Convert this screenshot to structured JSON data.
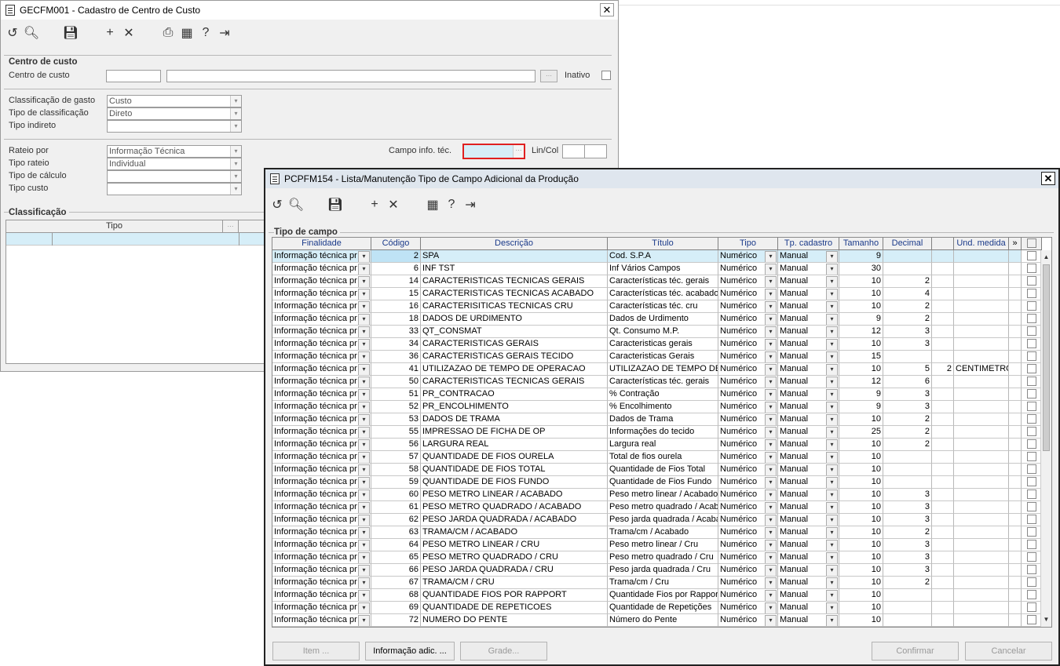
{
  "win1": {
    "title": "GECFM001 - Cadastro de Centro de Custo",
    "group_centro": "Centro de custo",
    "lbl_centro": "Centro de custo",
    "lbl_inativo": "Inativo",
    "lbl_class_gasto": "Classificação de gasto",
    "val_class_gasto": "Custo",
    "lbl_tipo_class": "Tipo de classificação",
    "val_tipo_class": "Direto",
    "lbl_tipo_indireto": "Tipo indireto",
    "lbl_rateio_por": "Rateio por",
    "val_rateio_por": "Informação Técnica",
    "lbl_tipo_rateio": "Tipo rateio",
    "val_tipo_rateio": "Individual",
    "lbl_tipo_calculo": "Tipo de cálculo",
    "lbl_tipo_custo": "Tipo custo",
    "lbl_campo_info": "Campo info. téc.",
    "lbl_lincol": "Lin/Col",
    "group_classif": "Classificação",
    "col_tipo": "Tipo"
  },
  "win2": {
    "title": "PCPFM154 - Lista/Manutenção Tipo de Campo Adicional da Produção",
    "group": "Tipo de campo",
    "columns": [
      "Finalidade",
      "Código",
      "Descrição",
      "Título",
      "Tipo",
      "Tp. cadastro",
      "Tamanho",
      "Decimal",
      "",
      "Und. medida",
      "»",
      ""
    ],
    "rows": [
      {
        "fin": "Informação técnica pr",
        "cod": "2",
        "desc": "SPA",
        "tit": "Cod. S.P.A",
        "tipo": "Numérico",
        "tpc": "Manual",
        "tam": "9",
        "dec": "",
        "x": "",
        "und": ""
      },
      {
        "fin": "Informação técnica pr",
        "cod": "6",
        "desc": "INF TST",
        "tit": "Inf Vários Campos",
        "tipo": "Numérico",
        "tpc": "Manual",
        "tam": "30",
        "dec": "",
        "x": "",
        "und": ""
      },
      {
        "fin": "Informação técnica pr",
        "cod": "14",
        "desc": "CARACTERISTICAS TECNICAS GERAIS",
        "tit": "Características téc. gerais",
        "tipo": "Numérico",
        "tpc": "Manual",
        "tam": "10",
        "dec": "2",
        "x": "",
        "und": ""
      },
      {
        "fin": "Informação técnica pr",
        "cod": "15",
        "desc": "CARACTERISTICAS TECNICAS ACABADO",
        "tit": "Características téc. acabado",
        "tipo": "Numérico",
        "tpc": "Manual",
        "tam": "10",
        "dec": "4",
        "x": "",
        "und": ""
      },
      {
        "fin": "Informação técnica pr",
        "cod": "16",
        "desc": "CARACTERISITICAS TECNICAS CRU",
        "tit": "Características téc. cru",
        "tipo": "Numérico",
        "tpc": "Manual",
        "tam": "10",
        "dec": "2",
        "x": "",
        "und": ""
      },
      {
        "fin": "Informação técnica pr",
        "cod": "18",
        "desc": "DADOS DE URDIMENTO",
        "tit": "Dados de Urdimento",
        "tipo": "Numérico",
        "tpc": "Manual",
        "tam": "9",
        "dec": "2",
        "x": "",
        "und": ""
      },
      {
        "fin": "Informação técnica pr",
        "cod": "33",
        "desc": "QT_CONSMAT",
        "tit": "Qt. Consumo M.P.",
        "tipo": "Numérico",
        "tpc": "Manual",
        "tam": "12",
        "dec": "3",
        "x": "",
        "und": ""
      },
      {
        "fin": "Informação técnica pr",
        "cod": "34",
        "desc": "CARACTERISTICAS GERAIS",
        "tit": "Caracteristicas gerais",
        "tipo": "Numérico",
        "tpc": "Manual",
        "tam": "10",
        "dec": "3",
        "x": "",
        "und": ""
      },
      {
        "fin": "Informação técnica pr",
        "cod": "36",
        "desc": "CARACTERISTICAS GERAIS TECIDO",
        "tit": "Caracteristicas Gerais",
        "tipo": "Numérico",
        "tpc": "Manual",
        "tam": "15",
        "dec": "",
        "x": "",
        "und": ""
      },
      {
        "fin": "Informação técnica pr",
        "cod": "41",
        "desc": "UTILIZAZAO DE TEMPO DE OPERACAO",
        "tit": "UTILIZAZAO DE TEMPO DE OP",
        "tipo": "Numérico",
        "tpc": "Manual",
        "tam": "10",
        "dec": "5",
        "x": "2",
        "und": "CENTIMETROS"
      },
      {
        "fin": "Informação técnica pr",
        "cod": "50",
        "desc": "CARACTERISTICAS TECNICAS GERAIS",
        "tit": "Características téc. gerais",
        "tipo": "Numérico",
        "tpc": "Manual",
        "tam": "12",
        "dec": "6",
        "x": "",
        "und": ""
      },
      {
        "fin": "Informação técnica pr",
        "cod": "51",
        "desc": "PR_CONTRACAO",
        "tit": "% Contração",
        "tipo": "Numérico",
        "tpc": "Manual",
        "tam": "9",
        "dec": "3",
        "x": "",
        "und": ""
      },
      {
        "fin": "Informação técnica pr",
        "cod": "52",
        "desc": "PR_ENCOLHIMENTO",
        "tit": "% Encolhimento",
        "tipo": "Numérico",
        "tpc": "Manual",
        "tam": "9",
        "dec": "3",
        "x": "",
        "und": ""
      },
      {
        "fin": "Informação técnica pr",
        "cod": "53",
        "desc": "DADOS DE TRAMA",
        "tit": "Dados de Trama",
        "tipo": "Numérico",
        "tpc": "Manual",
        "tam": "10",
        "dec": "2",
        "x": "",
        "und": ""
      },
      {
        "fin": "Informação técnica pr",
        "cod": "55",
        "desc": "IMPRESSAO DE FICHA DE OP",
        "tit": "Informações do tecido",
        "tipo": "Numérico",
        "tpc": "Manual",
        "tam": "25",
        "dec": "2",
        "x": "",
        "und": ""
      },
      {
        "fin": "Informação técnica pr",
        "cod": "56",
        "desc": "LARGURA REAL",
        "tit": "Largura real",
        "tipo": "Numérico",
        "tpc": "Manual",
        "tam": "10",
        "dec": "2",
        "x": "",
        "und": ""
      },
      {
        "fin": "Informação técnica pr",
        "cod": "57",
        "desc": "QUANTIDADE DE FIOS OURELA",
        "tit": "Total de fios ourela",
        "tipo": "Numérico",
        "tpc": "Manual",
        "tam": "10",
        "dec": "",
        "x": "",
        "und": ""
      },
      {
        "fin": "Informação técnica pr",
        "cod": "58",
        "desc": "QUANTIDADE DE FIOS TOTAL",
        "tit": "Quantidade de Fios Total",
        "tipo": "Numérico",
        "tpc": "Manual",
        "tam": "10",
        "dec": "",
        "x": "",
        "und": ""
      },
      {
        "fin": "Informação técnica pr",
        "cod": "59",
        "desc": "QUANTIDADE DE FIOS FUNDO",
        "tit": "Quantidade de Fios Fundo",
        "tipo": "Numérico",
        "tpc": "Manual",
        "tam": "10",
        "dec": "",
        "x": "",
        "und": ""
      },
      {
        "fin": "Informação técnica pr",
        "cod": "60",
        "desc": "PESO METRO LINEAR / ACABADO",
        "tit": "Peso metro linear / Acabado",
        "tipo": "Numérico",
        "tpc": "Manual",
        "tam": "10",
        "dec": "3",
        "x": "",
        "und": ""
      },
      {
        "fin": "Informação técnica pr",
        "cod": "61",
        "desc": "PESO METRO QUADRADO / ACABADO",
        "tit": "Peso metro quadrado / Acab",
        "tipo": "Numérico",
        "tpc": "Manual",
        "tam": "10",
        "dec": "3",
        "x": "",
        "und": ""
      },
      {
        "fin": "Informação técnica pr",
        "cod": "62",
        "desc": "PESO JARDA QUADRADA / ACABADO",
        "tit": "Peso jarda quadrada / Acaba",
        "tipo": "Numérico",
        "tpc": "Manual",
        "tam": "10",
        "dec": "3",
        "x": "",
        "und": ""
      },
      {
        "fin": "Informação técnica pr",
        "cod": "63",
        "desc": "TRAMA/CM / ACABADO",
        "tit": "Trama/cm / Acabado",
        "tipo": "Numérico",
        "tpc": "Manual",
        "tam": "10",
        "dec": "2",
        "x": "",
        "und": ""
      },
      {
        "fin": "Informação técnica pr",
        "cod": "64",
        "desc": "PESO METRO LINEAR / CRU",
        "tit": "Peso metro linear / Cru",
        "tipo": "Numérico",
        "tpc": "Manual",
        "tam": "10",
        "dec": "3",
        "x": "",
        "und": ""
      },
      {
        "fin": "Informação técnica pr",
        "cod": "65",
        "desc": "PESO METRO QUADRADO / CRU",
        "tit": "Peso metro quadrado / Cru",
        "tipo": "Numérico",
        "tpc": "Manual",
        "tam": "10",
        "dec": "3",
        "x": "",
        "und": ""
      },
      {
        "fin": "Informação técnica pr",
        "cod": "66",
        "desc": "PESO JARDA QUADRADA / CRU",
        "tit": "Peso jarda quadrada / Cru",
        "tipo": "Numérico",
        "tpc": "Manual",
        "tam": "10",
        "dec": "3",
        "x": "",
        "und": ""
      },
      {
        "fin": "Informação técnica pr",
        "cod": "67",
        "desc": "TRAMA/CM / CRU",
        "tit": "Trama/cm / Cru",
        "tipo": "Numérico",
        "tpc": "Manual",
        "tam": "10",
        "dec": "2",
        "x": "",
        "und": ""
      },
      {
        "fin": "Informação técnica pr",
        "cod": "68",
        "desc": "QUANTIDADE FIOS POR RAPPORT",
        "tit": "Quantidade Fios por Rapport",
        "tipo": "Numérico",
        "tpc": "Manual",
        "tam": "10",
        "dec": "",
        "x": "",
        "und": ""
      },
      {
        "fin": "Informação técnica pr",
        "cod": "69",
        "desc": "QUANTIDADE DE REPETICOES",
        "tit": "Quantidade de Repetições",
        "tipo": "Numérico",
        "tpc": "Manual",
        "tam": "10",
        "dec": "",
        "x": "",
        "und": ""
      },
      {
        "fin": "Informação técnica pr",
        "cod": "72",
        "desc": "NUMERO DO PENTE",
        "tit": "Número do Pente",
        "tipo": "Numérico",
        "tpc": "Manual",
        "tam": "10",
        "dec": "",
        "x": "",
        "und": ""
      }
    ],
    "btn_item": "Item ...",
    "btn_info": "Informação adic. ...",
    "btn_grade": "Grade...",
    "btn_confirmar": "Confirmar",
    "btn_cancelar": "Cancelar"
  }
}
